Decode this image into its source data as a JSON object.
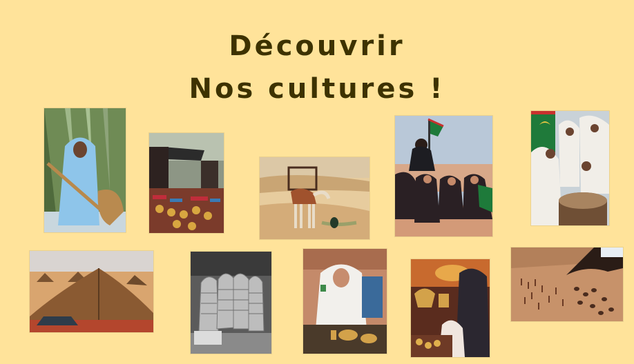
{
  "title": {
    "line1": "Découvrir",
    "line2": "Nos cultures !"
  },
  "colors": {
    "background": "#ffe39a",
    "title": "#3d3200"
  },
  "photos": [
    {
      "icon": "woman-with-pestle-photo"
    },
    {
      "icon": "market-stall-photo"
    },
    {
      "icon": "camel-in-desert-photo"
    },
    {
      "icon": "women-with-flag-photo"
    },
    {
      "icon": "women-with-drum-photo"
    },
    {
      "icon": "desert-tents-photo"
    },
    {
      "icon": "manuscripts-photo"
    },
    {
      "icon": "woman-serving-tea-photo"
    },
    {
      "icon": "tea-ceremony-photo"
    },
    {
      "icon": "sand-board-game-photo"
    }
  ]
}
